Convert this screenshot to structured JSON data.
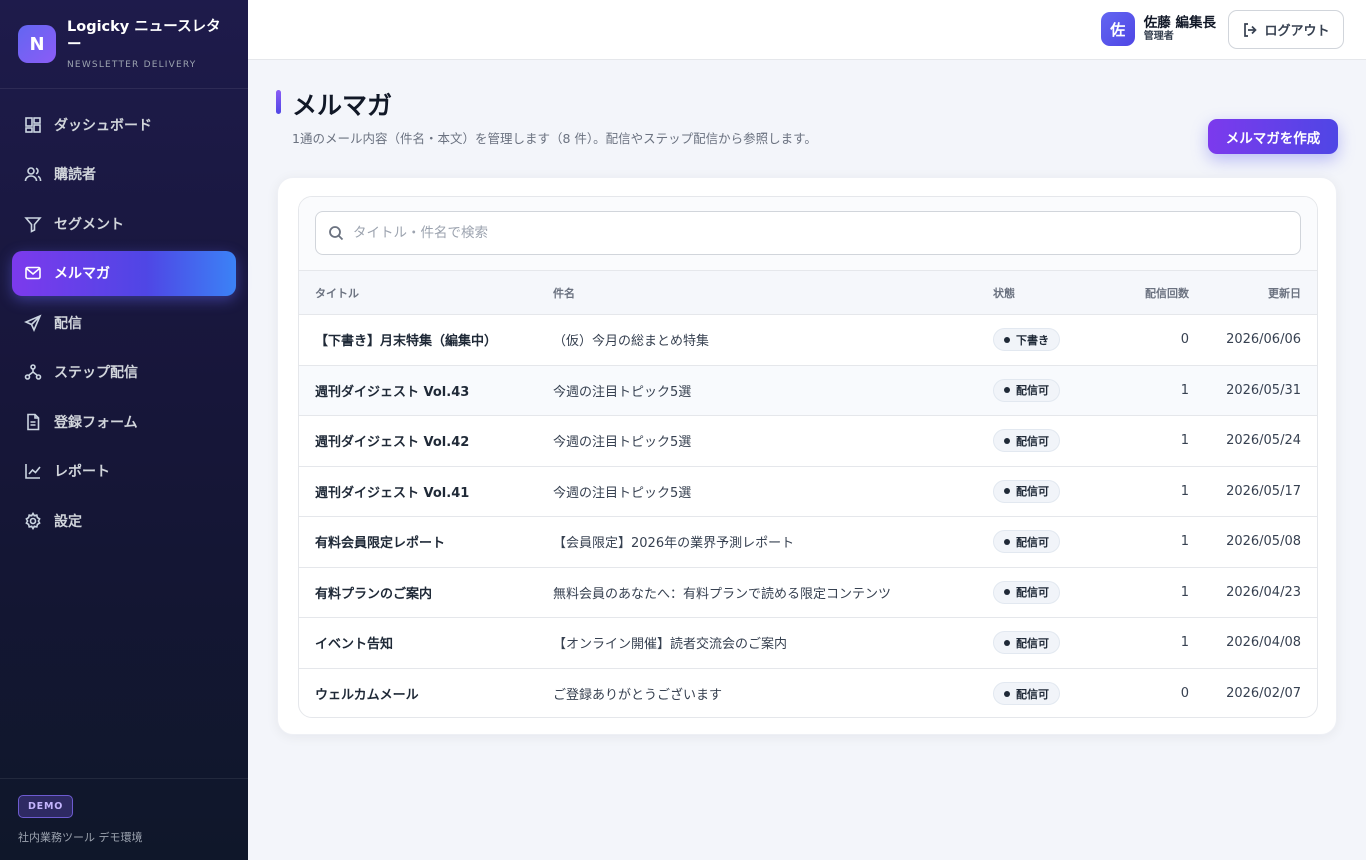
{
  "brand": {
    "logo_letter": "N",
    "name": "Logicky ニュースレター",
    "sub": "NEWSLETTER DELIVERY"
  },
  "sidebar": {
    "items": [
      {
        "label": "ダッシュボード",
        "icon": "dashboard-icon"
      },
      {
        "label": "購読者",
        "icon": "users-icon"
      },
      {
        "label": "セグメント",
        "icon": "filter-icon"
      },
      {
        "label": "メルマガ",
        "icon": "mail-icon",
        "active": true
      },
      {
        "label": "配信",
        "icon": "send-icon"
      },
      {
        "label": "ステップ配信",
        "icon": "flow-icon"
      },
      {
        "label": "登録フォーム",
        "icon": "form-icon"
      },
      {
        "label": "レポート",
        "icon": "chart-icon"
      },
      {
        "label": "設定",
        "icon": "gear-icon"
      }
    ],
    "footer_badge": "DEMO",
    "footer_text": "社内業務ツール デモ環境"
  },
  "topbar": {
    "avatar_letter": "佐",
    "user_name": "佐藤 編集長",
    "user_role": "管理者",
    "logout_label": "ログアウト"
  },
  "page": {
    "title": "メルマガ",
    "description": "1通のメール内容（件名・本文）を管理します（8 件）。配信やステップ配信から参照します。",
    "create_label": "メルマガを作成"
  },
  "search": {
    "placeholder": "タイトル・件名で検索",
    "value": ""
  },
  "table": {
    "headers": {
      "title": "タイトル",
      "subject": "件名",
      "status": "状態",
      "count": "配信回数",
      "updated": "更新日"
    },
    "rows": [
      {
        "title": "【下書き】月末特集（編集中）",
        "subject": "（仮）今月の総まとめ特集",
        "status": "下書き",
        "count": "0",
        "updated": "2026/06/06"
      },
      {
        "title": "週刊ダイジェスト Vol.43",
        "subject": "今週の注目トピック5選",
        "status": "配信可",
        "count": "1",
        "updated": "2026/05/31"
      },
      {
        "title": "週刊ダイジェスト Vol.42",
        "subject": "今週の注目トピック5選",
        "status": "配信可",
        "count": "1",
        "updated": "2026/05/24"
      },
      {
        "title": "週刊ダイジェスト Vol.41",
        "subject": "今週の注目トピック5選",
        "status": "配信可",
        "count": "1",
        "updated": "2026/05/17"
      },
      {
        "title": "有料会員限定レポート",
        "subject": "【会員限定】2026年の業界予測レポート",
        "status": "配信可",
        "count": "1",
        "updated": "2026/05/08"
      },
      {
        "title": "有料プランのご案内",
        "subject": "無料会員のあなたへ：有料プランで読める限定コンテンツ",
        "status": "配信可",
        "count": "1",
        "updated": "2026/04/23"
      },
      {
        "title": "イベント告知",
        "subject": "【オンライン開催】読者交流会のご案内",
        "status": "配信可",
        "count": "1",
        "updated": "2026/04/08"
      },
      {
        "title": "ウェルカムメール",
        "subject": "ご登録ありがとうございます",
        "status": "配信可",
        "count": "0",
        "updated": "2026/02/07"
      }
    ]
  },
  "colors": {
    "accent": "#6366f1",
    "sidebar_bg": "#1e1b4b",
    "page_bg": "#f3f5fa"
  }
}
